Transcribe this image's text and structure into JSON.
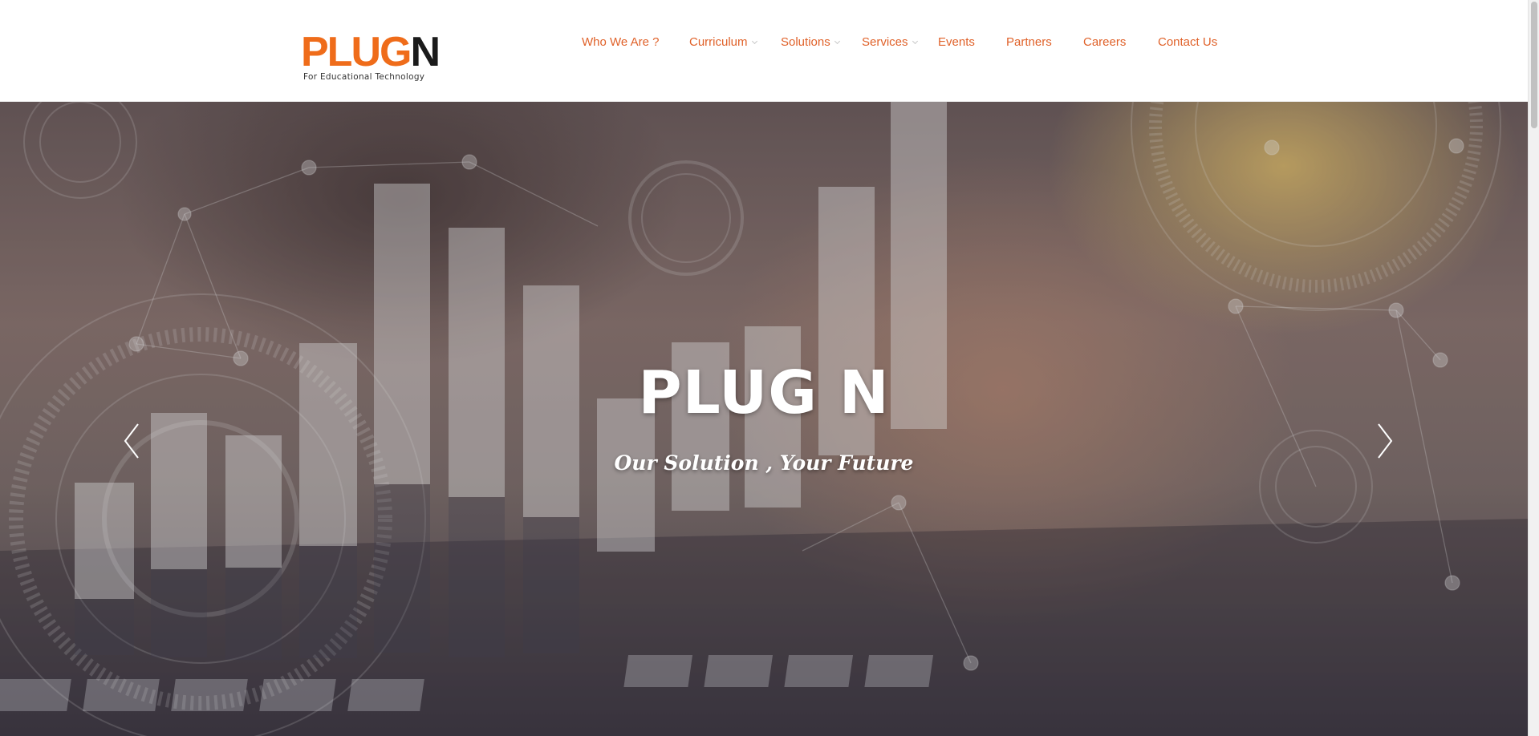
{
  "brand": {
    "logo_text_orange": "PLUG",
    "logo_text_dark": "N",
    "tagline": "For Educational Technology",
    "accent_color": "#e0622a"
  },
  "nav": {
    "items": [
      {
        "label": "Who We Are ?",
        "has_dropdown": false
      },
      {
        "label": "Curriculum",
        "has_dropdown": true
      },
      {
        "label": "Solutions",
        "has_dropdown": true
      },
      {
        "label": "Services",
        "has_dropdown": true
      },
      {
        "label": "Events",
        "has_dropdown": false
      },
      {
        "label": "Partners",
        "has_dropdown": false
      },
      {
        "label": "Careers",
        "has_dropdown": false
      },
      {
        "label": "Contact Us",
        "has_dropdown": false
      }
    ]
  },
  "hero": {
    "title": "PLUG N",
    "subtitle": "Our Solution , Your Future",
    "prev_icon": "chevron-left-icon",
    "next_icon": "chevron-right-icon"
  }
}
